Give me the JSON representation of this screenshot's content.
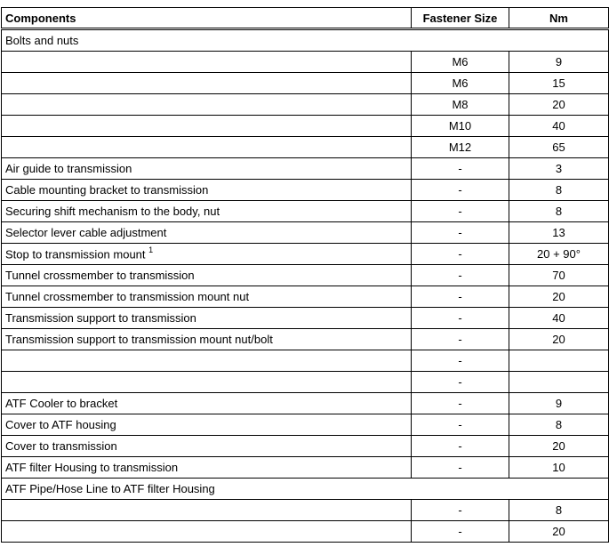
{
  "table": {
    "headers": {
      "components": "Components",
      "fastener_size": "Fastener Size",
      "nm": "Nm"
    },
    "rows": [
      {
        "type": "section",
        "component": "Bolts and nuts"
      },
      {
        "type": "row",
        "component": "",
        "size": "M6",
        "nm": "9"
      },
      {
        "type": "row",
        "component": "",
        "size": "M6",
        "nm": "15"
      },
      {
        "type": "row",
        "component": "",
        "size": "M8",
        "nm": "20"
      },
      {
        "type": "row",
        "component": "",
        "size": "M10",
        "nm": "40"
      },
      {
        "type": "row",
        "component": "",
        "size": "M12",
        "nm": "65"
      },
      {
        "type": "row",
        "component": "Air guide to transmission",
        "size": "-",
        "nm": "3"
      },
      {
        "type": "row",
        "component": "Cable mounting bracket to transmission",
        "size": "-",
        "nm": "8"
      },
      {
        "type": "row",
        "component": "Securing shift mechanism to the body, nut",
        "size": "-",
        "nm": "8"
      },
      {
        "type": "row",
        "component": "Selector lever cable adjustment",
        "size": "-",
        "nm": "13"
      },
      {
        "type": "row",
        "component": "Stop to transmission mount",
        "footnote": "1",
        "size": "-",
        "nm": "20 + 90°"
      },
      {
        "type": "row",
        "component": "Tunnel crossmember to transmission",
        "size": "-",
        "nm": "70"
      },
      {
        "type": "row",
        "component": "Tunnel crossmember to transmission mount nut",
        "size": "-",
        "nm": "20"
      },
      {
        "type": "row",
        "component": "Transmission support to transmission",
        "size": "-",
        "nm": "40"
      },
      {
        "type": "row",
        "component": "Transmission support to transmission mount nut/bolt",
        "size": "-",
        "nm": "20"
      },
      {
        "type": "row",
        "component": "",
        "size": "-",
        "nm": ""
      },
      {
        "type": "row",
        "component": "",
        "size": "-",
        "nm": ""
      },
      {
        "type": "row",
        "component": "ATF Cooler to bracket",
        "size": "-",
        "nm": "9"
      },
      {
        "type": "row",
        "component": "Cover to ATF housing",
        "size": "-",
        "nm": "8"
      },
      {
        "type": "row",
        "component": "Cover to transmission",
        "size": "-",
        "nm": "20"
      },
      {
        "type": "row",
        "component": "ATF filter Housing to transmission",
        "size": "-",
        "nm": "10"
      },
      {
        "type": "section",
        "component": "ATF Pipe/Hose Line to ATF filter Housing"
      },
      {
        "type": "row",
        "component": "",
        "size": "-",
        "nm": "8"
      },
      {
        "type": "row",
        "component": "",
        "size": "-",
        "nm": "20"
      }
    ]
  }
}
